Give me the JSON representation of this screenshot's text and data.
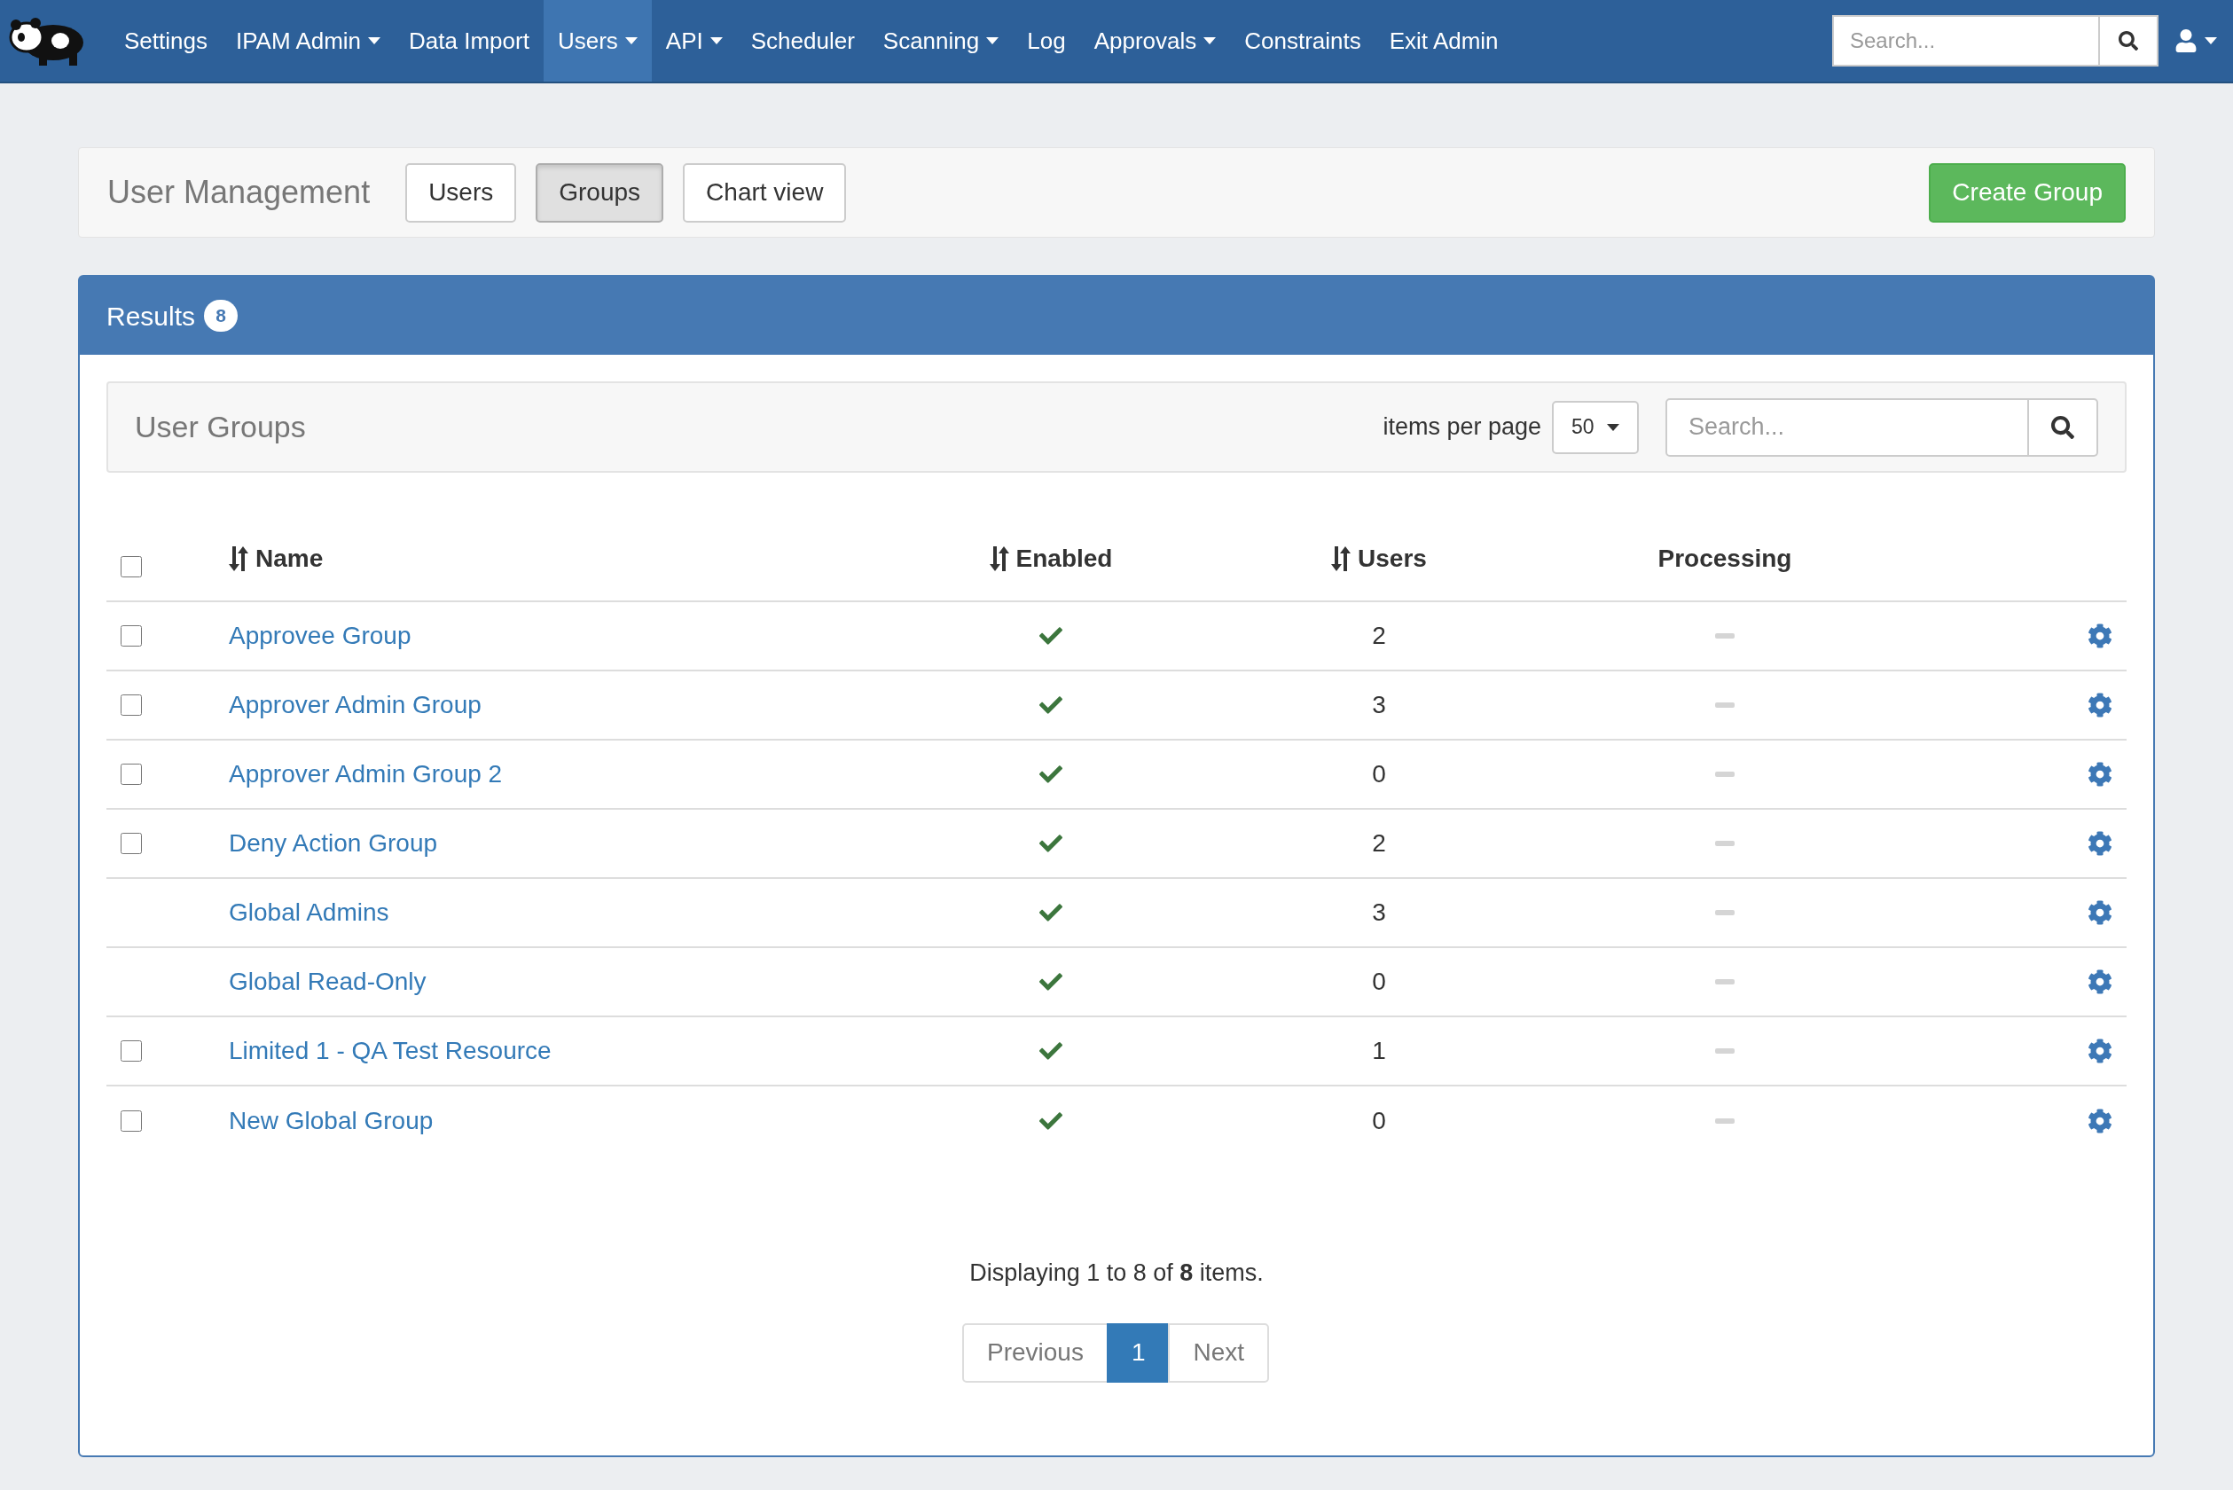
{
  "navbar": {
    "items": [
      {
        "label": "Settings",
        "dropdown": false,
        "selected": false
      },
      {
        "label": "IPAM Admin",
        "dropdown": true,
        "selected": false
      },
      {
        "label": "Data Import",
        "dropdown": false,
        "selected": false
      },
      {
        "label": "Users",
        "dropdown": true,
        "selected": true
      },
      {
        "label": "API",
        "dropdown": true,
        "selected": false
      },
      {
        "label": "Scheduler",
        "dropdown": false,
        "selected": false
      },
      {
        "label": "Scanning",
        "dropdown": true,
        "selected": false
      },
      {
        "label": "Log",
        "dropdown": false,
        "selected": false
      },
      {
        "label": "Approvals",
        "dropdown": true,
        "selected": false
      },
      {
        "label": "Constraints",
        "dropdown": false,
        "selected": false
      },
      {
        "label": "Exit Admin",
        "dropdown": false,
        "selected": false
      }
    ],
    "search": {
      "placeholder": "Search..."
    }
  },
  "toolbar": {
    "title": "User Management",
    "tabs": [
      {
        "label": "Users",
        "selected": false
      },
      {
        "label": "Groups",
        "selected": true
      },
      {
        "label": "Chart view",
        "selected": false
      }
    ],
    "action": "Create Group"
  },
  "results": {
    "title": "Results",
    "count": "8",
    "filter_bar": {
      "title": "User Groups",
      "items_per_page_label": "items per page",
      "items_per_page": "50",
      "search": {
        "placeholder": "Search..."
      }
    },
    "table": {
      "select_all": {
        "checked": false
      },
      "columns": [
        {
          "label": "Name",
          "sortable": true
        },
        {
          "label": "Enabled",
          "sortable": true
        },
        {
          "label": "Users",
          "sortable": true
        },
        {
          "label": "Processing",
          "sortable": false
        }
      ],
      "rows": [
        {
          "selectable": true,
          "checked": false,
          "name": "Approvee Group",
          "enabled": true,
          "users": "2",
          "processing": false
        },
        {
          "selectable": true,
          "checked": false,
          "name": "Approver Admin Group",
          "enabled": true,
          "users": "3",
          "processing": false
        },
        {
          "selectable": true,
          "checked": false,
          "name": "Approver Admin Group 2",
          "enabled": true,
          "users": "0",
          "processing": false
        },
        {
          "selectable": true,
          "checked": false,
          "name": "Deny Action Group",
          "enabled": true,
          "users": "2",
          "processing": false
        },
        {
          "selectable": false,
          "name": "Global Admins",
          "enabled": true,
          "users": "3",
          "processing": false
        },
        {
          "selectable": false,
          "name": "Global Read-Only",
          "enabled": true,
          "users": "0",
          "processing": false
        },
        {
          "selectable": true,
          "checked": false,
          "name": "Limited 1 - QA Test Resource",
          "enabled": true,
          "users": "1",
          "processing": false
        },
        {
          "selectable": true,
          "checked": false,
          "name": "New Global Group",
          "enabled": true,
          "users": "0",
          "processing": false
        }
      ]
    },
    "summary": "Displaying 1 to 8 of **8** items.",
    "pagination": [
      {
        "label": "Previous",
        "selected": false
      },
      {
        "label": "1",
        "selected": true
      },
      {
        "label": "Next",
        "selected": false
      }
    ]
  }
}
